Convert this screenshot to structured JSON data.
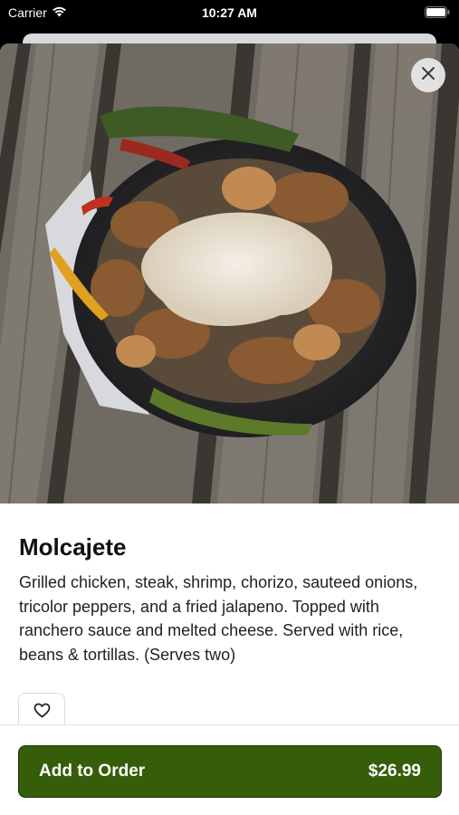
{
  "status_bar": {
    "carrier": "Carrier",
    "time": "10:27 AM",
    "wifi_icon": "wifi-icon",
    "battery_icon": "battery-icon"
  },
  "item": {
    "title": "Molcajete",
    "description": "Grilled chicken, steak, shrimp, chorizo, sauteed onions, tricolor peppers, and a fried jalapeno. Topped with ranchero sauce and melted cheese. Served with rice, beans & tortillas. (Serves two)",
    "image_icon": "food-photo"
  },
  "actions": {
    "close_icon": "close-icon",
    "favorite_icon": "heart-icon",
    "add_to_order_label": "Add to Order",
    "price": "$26.99"
  },
  "colors": {
    "accent": "#365e0a",
    "accent_border": "#1c3605",
    "text": "#111111"
  }
}
